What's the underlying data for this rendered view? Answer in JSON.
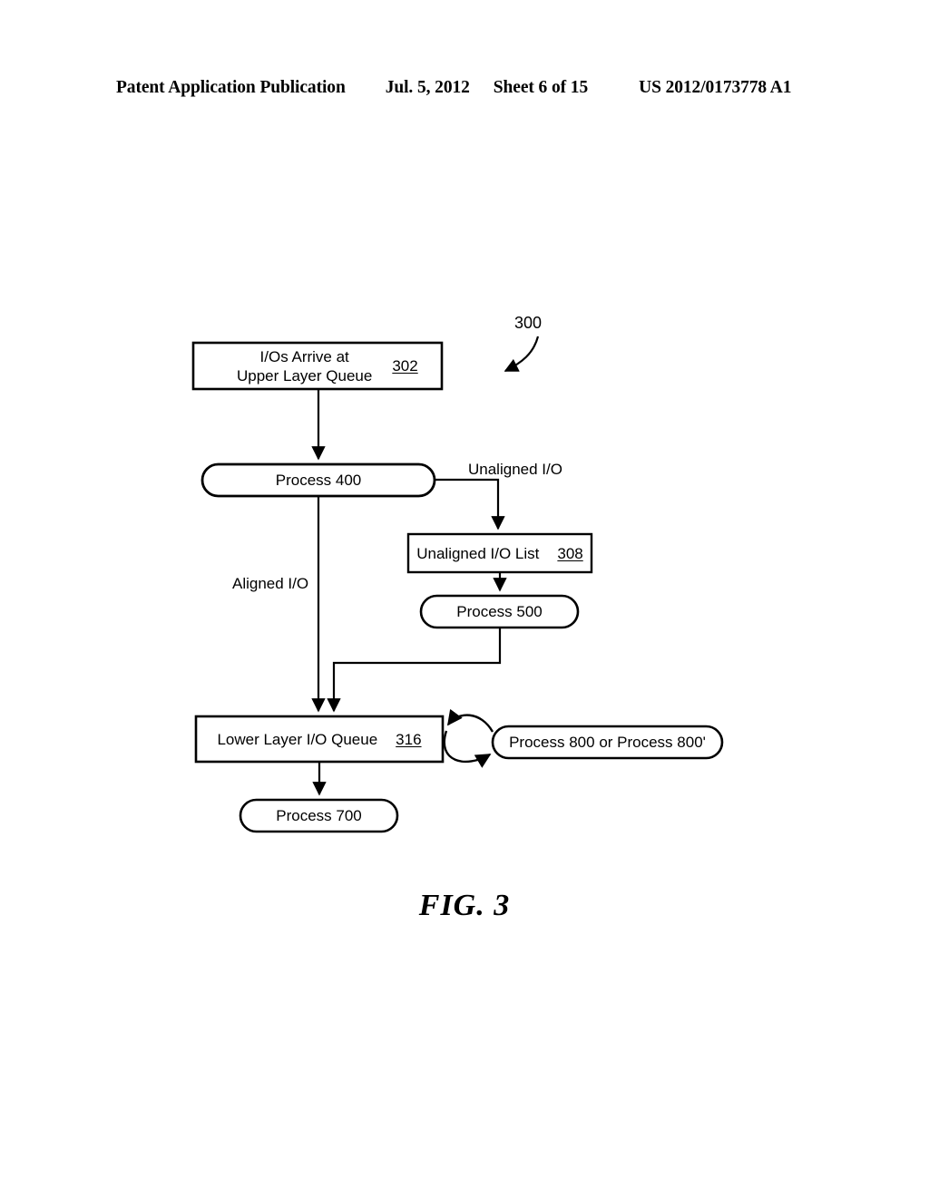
{
  "header": {
    "publication": "Patent Application Publication",
    "date": "Jul. 5, 2012",
    "sheet": "Sheet 6 of 15",
    "number": "US 2012/0173778 A1"
  },
  "figure": {
    "caption": "FIG. 3",
    "diagram_ref": "300",
    "nodes": {
      "arrive": {
        "line1": "I/Os Arrive at",
        "line2": "Upper Layer Queue",
        "ref": "302",
        "shape": "rectangle"
      },
      "process400": {
        "label": "Process 400",
        "shape": "stadium"
      },
      "unaligned_list": {
        "label": "Unaligned I/O List",
        "ref": "308",
        "shape": "rectangle"
      },
      "process500": {
        "label": "Process 500",
        "shape": "stadium"
      },
      "lower_queue": {
        "label": "Lower Layer I/O Queue",
        "ref": "316",
        "shape": "rectangle"
      },
      "process800": {
        "label": "Process 800 or Process 800'",
        "shape": "stadium"
      },
      "process700": {
        "label": "Process 700",
        "shape": "stadium"
      }
    },
    "edges": {
      "unaligned": "Unaligned I/O",
      "aligned": "Aligned I/O"
    }
  },
  "colors": {
    "ink": "#000000",
    "paper": "#ffffff"
  }
}
